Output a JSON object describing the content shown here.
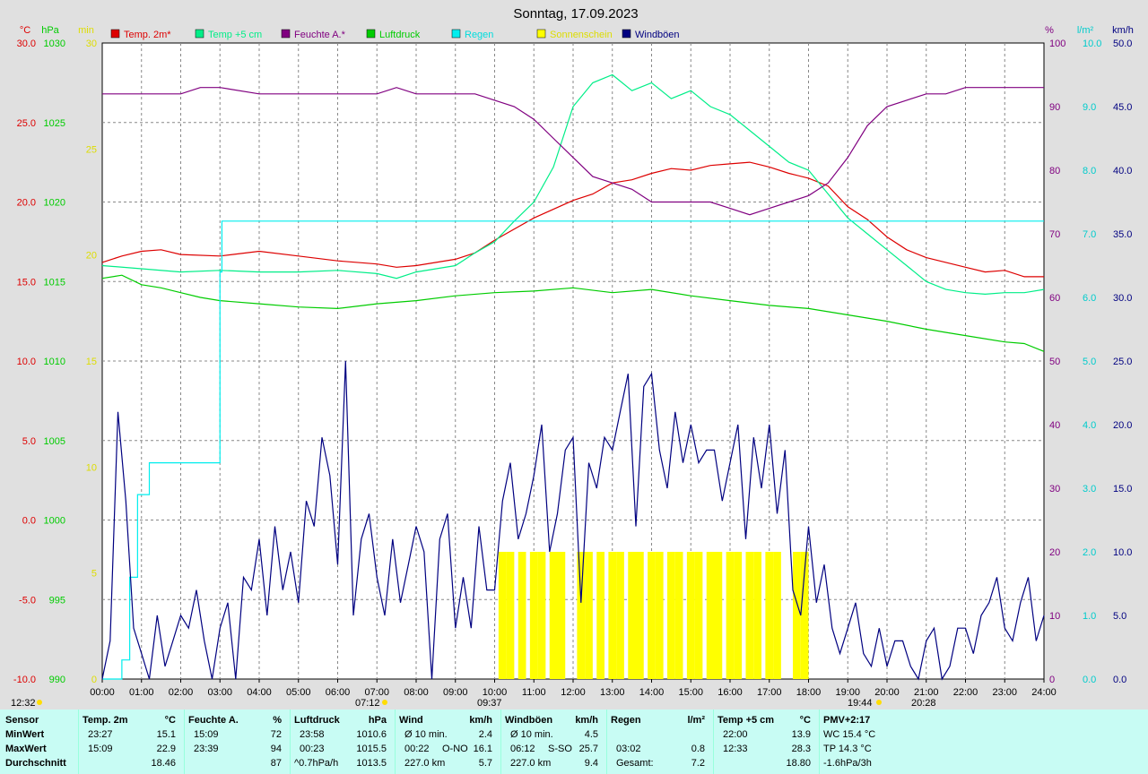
{
  "title": "Sonntag, 17.09.2023",
  "axis_headers": {
    "celsius": "°C",
    "hpa": "hPa",
    "min": "min",
    "percent": "%",
    "rain": "l/m²",
    "wind": "km/h"
  },
  "left_ticks": {
    "celsius": [
      "30.0",
      "25.0",
      "20.0",
      "15.0",
      "10.0",
      "5.0",
      "0.0",
      "-5.0",
      "-10.0"
    ],
    "hpa": [
      "1030",
      "1025",
      "1020",
      "1015",
      "1010",
      "1005",
      "1000",
      "995",
      "990"
    ],
    "min": [
      "30",
      "25",
      "20",
      "15",
      "10",
      "5",
      "0"
    ]
  },
  "right_ticks": {
    "percent": [
      "100",
      "90",
      "80",
      "70",
      "60",
      "50",
      "40",
      "30",
      "20",
      "10",
      "0"
    ],
    "rain": [
      "10.0",
      "9.0",
      "8.0",
      "7.0",
      "6.0",
      "5.0",
      "4.0",
      "3.0",
      "2.0",
      "1.0",
      "0.0"
    ],
    "wind": [
      "50.0",
      "45.0",
      "40.0",
      "35.0",
      "30.0",
      "25.0",
      "20.0",
      "15.0",
      "10.0",
      "5.0",
      "0.0"
    ]
  },
  "x_ticks": [
    "00:00",
    "01:00",
    "02:00",
    "03:00",
    "04:00",
    "05:00",
    "06:00",
    "07:00",
    "08:00",
    "09:00",
    "10:00",
    "11:00",
    "12:00",
    "13:00",
    "14:00",
    "15:00",
    "16:00",
    "17:00",
    "18:00",
    "19:00",
    "20:00",
    "21:00",
    "22:00",
    "23:00",
    "24:00"
  ],
  "sun_marks": {
    "moonset": "12:32",
    "sunrise": "07:12",
    "noon": "09:37",
    "sunset": "19:44",
    "moonrise": "20:28"
  },
  "legend": [
    {
      "label": "Temp. 2m*",
      "color": "#dd0000"
    },
    {
      "label": "Temp +5 cm",
      "color": "#00ee88"
    },
    {
      "label": "Feuchte A.*",
      "color": "#800080"
    },
    {
      "label": "Luftdruck",
      "color": "#00cc00"
    },
    {
      "label": "Regen",
      "color": "#00eeee"
    },
    {
      "label": "Sonnenschein",
      "color": "#ffff00"
    },
    {
      "label": "Windböen",
      "color": "#000080"
    }
  ],
  "chart_data": {
    "type": "line",
    "x_range": [
      "00:00",
      "24:00"
    ],
    "axes": {
      "temperature_c": [
        -10,
        30
      ],
      "pressure_hpa": [
        990,
        1030
      ],
      "sunshine_min": [
        0,
        30
      ],
      "humidity_pct": [
        0,
        100
      ],
      "rain_l_m2": [
        0,
        10
      ],
      "wind_kmh": [
        0,
        50
      ]
    },
    "grid": true,
    "series": [
      {
        "name": "Temp. 2m*",
        "axis": "temperature_c",
        "x_hours": [
          0,
          0.5,
          1,
          1.5,
          2,
          3,
          4,
          5,
          6,
          7,
          7.5,
          8,
          9,
          9.5,
          10,
          11,
          12,
          12.5,
          13,
          13.5,
          14,
          14.5,
          15,
          15.5,
          16,
          16.5,
          17,
          17.5,
          18,
          18.5,
          19,
          19.5,
          20,
          20.5,
          21,
          21.5,
          22,
          22.5,
          23,
          23.5,
          24
        ],
        "values": [
          16.2,
          16.6,
          16.9,
          17.0,
          16.7,
          16.6,
          16.9,
          16.6,
          16.3,
          16.1,
          15.9,
          16.0,
          16.4,
          16.8,
          17.6,
          19.0,
          20.1,
          20.5,
          21.2,
          21.4,
          21.8,
          22.1,
          22.0,
          22.3,
          22.4,
          22.5,
          22.2,
          21.8,
          21.5,
          21.0,
          19.7,
          18.9,
          17.8,
          17.0,
          16.5,
          16.2,
          15.9,
          15.6,
          15.7,
          15.3,
          15.3
        ]
      },
      {
        "name": "Temp +5 cm",
        "axis": "temperature_c",
        "x_hours": [
          0,
          1,
          2,
          3,
          4,
          5,
          6,
          7,
          7.5,
          8,
          9,
          9.5,
          10,
          10.5,
          11,
          11.5,
          12,
          12.5,
          13,
          13.5,
          14,
          14.5,
          15,
          15.5,
          16,
          16.5,
          17,
          17.5,
          18,
          18.5,
          19,
          19.5,
          20,
          20.5,
          21,
          21.5,
          22,
          22.5,
          23,
          23.5,
          24
        ],
        "values": [
          16.0,
          15.8,
          15.6,
          15.7,
          15.6,
          15.6,
          15.7,
          15.5,
          15.2,
          15.6,
          16.0,
          16.8,
          17.5,
          18.8,
          20.0,
          22.2,
          26.0,
          27.5,
          28.0,
          27.0,
          27.5,
          26.5,
          27.0,
          26.0,
          25.5,
          24.5,
          23.5,
          22.5,
          22.0,
          20.5,
          19.0,
          18.0,
          17.0,
          16.0,
          15.0,
          14.5,
          14.3,
          14.2,
          14.3,
          14.3,
          14.5
        ]
      },
      {
        "name": "Feuchte A.*",
        "axis": "humidity_pct",
        "x_hours": [
          0,
          1,
          1.5,
          2,
          2.5,
          3,
          4,
          5,
          6,
          7,
          7.5,
          8,
          9,
          9.5,
          10,
          10.5,
          11,
          11.5,
          12,
          12.5,
          13,
          13.5,
          14,
          14.5,
          15,
          15.5,
          16,
          16.5,
          17,
          17.5,
          18,
          18.5,
          19,
          19.5,
          20,
          20.5,
          21,
          21.5,
          22,
          22.5,
          23,
          23.5,
          24
        ],
        "values": [
          92,
          92,
          92,
          92,
          93,
          93,
          92,
          92,
          92,
          92,
          93,
          92,
          92,
          92,
          91,
          90,
          88,
          85,
          82,
          79,
          78,
          77,
          75,
          75,
          75,
          75,
          74,
          73,
          74,
          75,
          76,
          78,
          82,
          87,
          90,
          91,
          92,
          92,
          93,
          93,
          93,
          93,
          93
        ]
      },
      {
        "name": "Luftdruck",
        "axis": "pressure_hpa",
        "x_hours": [
          0,
          0.5,
          1,
          1.5,
          2,
          2.5,
          3,
          4,
          5,
          6,
          7,
          8,
          9,
          10,
          11,
          12,
          13,
          14,
          15,
          16,
          17,
          18,
          19,
          20,
          21,
          22,
          23,
          23.5,
          24
        ],
        "values": [
          1015.2,
          1015.4,
          1014.8,
          1014.6,
          1014.3,
          1014.0,
          1013.8,
          1013.6,
          1013.4,
          1013.3,
          1013.6,
          1013.8,
          1014.1,
          1014.3,
          1014.4,
          1014.6,
          1014.3,
          1014.5,
          1014.1,
          1013.8,
          1013.5,
          1013.3,
          1012.9,
          1012.5,
          1012.0,
          1011.6,
          1011.2,
          1011.1,
          1010.6
        ]
      },
      {
        "name": "Regen",
        "axis": "rain_l_m2",
        "x_hours": [
          0,
          0.3,
          0.5,
          0.7,
          0.9,
          1.2,
          2.0,
          2.9,
          3.0,
          3.05,
          3.1,
          24
        ],
        "values": [
          0,
          0,
          0.3,
          1.6,
          2.9,
          3.4,
          3.4,
          3.4,
          6.4,
          7.2,
          7.2,
          7.2
        ]
      },
      {
        "name": "Windböen",
        "axis": "wind_kmh",
        "x_hours": [
          0,
          0.2,
          0.4,
          0.6,
          0.8,
          1,
          1.2,
          1.4,
          1.6,
          1.8,
          2,
          2.2,
          2.4,
          2.6,
          2.8,
          3,
          3.2,
          3.4,
          3.6,
          3.8,
          4,
          4.2,
          4.4,
          4.6,
          4.8,
          5,
          5.2,
          5.4,
          5.6,
          5.8,
          6,
          6.2,
          6.4,
          6.6,
          6.8,
          7,
          7.2,
          7.4,
          7.6,
          7.8,
          8,
          8.2,
          8.4,
          8.6,
          8.8,
          9,
          9.2,
          9.4,
          9.6,
          9.8,
          10,
          10.2,
          10.4,
          10.6,
          10.8,
          11,
          11.2,
          11.4,
          11.6,
          11.8,
          12,
          12.2,
          12.4,
          12.6,
          12.8,
          13,
          13.2,
          13.4,
          13.6,
          13.8,
          14,
          14.2,
          14.4,
          14.6,
          14.8,
          15,
          15.2,
          15.4,
          15.6,
          15.8,
          16,
          16.2,
          16.4,
          16.6,
          16.8,
          17,
          17.2,
          17.4,
          17.6,
          17.8,
          18,
          18.2,
          18.4,
          18.6,
          18.8,
          19,
          19.2,
          19.4,
          19.6,
          19.8,
          20,
          20.2,
          20.4,
          20.6,
          20.8,
          21,
          21.2,
          21.4,
          21.6,
          21.8,
          22,
          22.2,
          22.4,
          22.6,
          22.8,
          23,
          23.2,
          23.4,
          23.6,
          23.8,
          24
        ],
        "values": [
          0,
          3,
          21,
          14,
          4,
          2,
          0,
          5,
          1,
          3,
          5,
          4,
          7,
          3,
          0,
          4,
          6,
          0,
          8,
          7,
          11,
          5,
          12,
          7,
          10,
          6,
          14,
          12,
          19,
          16,
          9,
          25,
          5,
          11,
          13,
          8,
          5,
          11,
          6,
          9,
          12,
          10,
          0,
          11,
          13,
          4,
          8,
          4,
          12,
          7,
          7,
          14,
          17,
          11,
          13,
          16,
          20,
          10,
          13,
          18,
          19,
          6,
          17,
          15,
          19,
          18,
          21,
          24,
          12,
          23,
          24,
          18,
          15,
          21,
          17,
          20,
          17,
          18,
          18,
          14,
          17,
          20,
          11,
          19,
          15,
          20,
          13,
          18,
          7,
          5,
          12,
          6,
          9,
          4,
          2,
          4,
          6,
          2,
          1,
          4,
          1,
          3,
          3,
          1,
          0,
          3,
          4,
          0,
          1,
          4,
          4,
          2,
          5,
          6,
          8,
          4,
          3,
          6,
          8,
          3,
          5
        ]
      },
      {
        "name": "Sonnenschein",
        "axis": "sunshine_min",
        "type": "bar",
        "x_hours": [
          10.1,
          10.3,
          10.6,
          10.9,
          11.1,
          11.4,
          11.6,
          12.1,
          12.3,
          12.6,
          12.9,
          13.1,
          13.4,
          13.6,
          13.9,
          14.1,
          14.4,
          14.6,
          14.9,
          15.1,
          15.4,
          15.6,
          15.9,
          16.1,
          16.4,
          16.6,
          16.9,
          17.1,
          17.6,
          17.8
        ],
        "values": [
          6,
          6,
          6,
          6,
          6,
          6,
          6,
          6,
          6,
          6,
          6,
          6,
          6,
          6,
          6,
          6,
          6,
          6,
          6,
          6,
          6,
          6,
          6,
          6,
          6,
          6,
          6,
          6,
          6,
          6
        ]
      }
    ]
  },
  "table": {
    "columns": [
      {
        "header": "Sensor",
        "unit": "",
        "min_time": "MinWert",
        "max_time": "MaxWert",
        "avg": "Durchschnitt"
      },
      {
        "header": "Temp. 2m",
        "unit": "°C",
        "min_time": "23:27",
        "min_val": "15.1",
        "max_time": "15:09",
        "max_val": "22.9",
        "avg_val": "18.46"
      },
      {
        "header": "Feuchte A.",
        "unit": "%",
        "min_time": "15:09",
        "min_val": "72",
        "max_time": "23:39",
        "max_val": "94",
        "avg_val": "87"
      },
      {
        "header": "Luftdruck",
        "unit": "hPa",
        "min_time": "23:58",
        "min_val": "1010.6",
        "max_time": "00:23",
        "max_val": "1015.5",
        "avg_label": "^0.7hPa/h",
        "avg_val": "1013.5"
      },
      {
        "header": "Wind",
        "unit": "km/h",
        "min_time": "Ø 10 min.",
        "min_val": "2.4",
        "max_time": "00:22",
        "max_mid": "O-NO",
        "max_val": "16.1",
        "avg_label": "227.0 km",
        "avg_val": "5.7"
      },
      {
        "header": "Windböen",
        "unit": "km/h",
        "min_time": "Ø 10 min.",
        "min_val": "4.5",
        "max_time": "06:12",
        "max_mid": "S-SO",
        "max_val": "25.7",
        "avg_label": "227.0 km",
        "avg_val": "9.4"
      },
      {
        "header": "Regen",
        "unit": "l/m²",
        "max_time": "03:02",
        "max_val": "0.8",
        "avg_label": "Gesamt:",
        "avg_val": "7.2"
      },
      {
        "header": "Temp +5 cm",
        "unit": "°C",
        "min_time": "22:00",
        "min_val": "13.9",
        "max_time": "12:33",
        "max_val": "28.3",
        "avg_val": "18.80"
      },
      {
        "header": "PMV+2:17",
        "unit": "",
        "min_time": "WC 15.4 °C",
        "max_time": "TP 14.3 °C",
        "avg_label": "-1.6hPa/3h"
      }
    ]
  }
}
